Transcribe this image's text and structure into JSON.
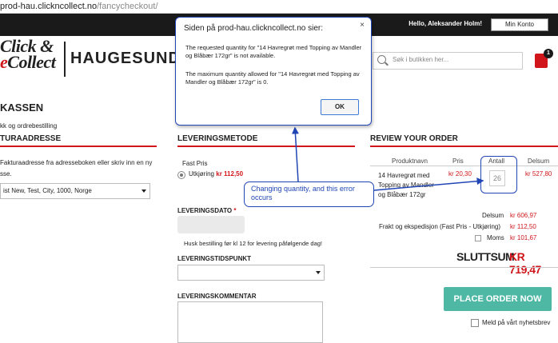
{
  "browser": {
    "url_host": "prod-hau.clickncollect.no",
    "url_path": "/fancycheckout/"
  },
  "topbar": {
    "greeting": "Hello, Aleksander Holm!",
    "account_button": "Min Konto"
  },
  "header": {
    "logo_line1": "Click &",
    "logo_line2_red": "e",
    "logo_line2": "Collect",
    "store_name": "HAUGESUND",
    "search_placeholder": "Søk i butikken her...",
    "cart_count": "1"
  },
  "left": {
    "title": "KASSEN",
    "subtitle": "kk og ordrebestilling",
    "section_title": "TURAADRESSE",
    "help_text": "Fakturaadresse fra adresseboken eller skriv inn en ny",
    "help_text2": "sse.",
    "address_select": "ist New, Test, City, 1000, Norge"
  },
  "delivery": {
    "section_title": "LEVERINGSMETODE",
    "fast_pris_label": "Fast Pris",
    "option_label": "Utkjøring",
    "option_price": "kr 112,50",
    "date_label": "LEVERINGSDATO",
    "date_required": "*",
    "date_note": "Husk bestilling før kl 12 for levering påfølgende dag!",
    "time_label": "LEVERINGSTIDSPUNKT",
    "comment_label": "LEVERINGSKOMMENTAR"
  },
  "review": {
    "section_title": "REVIEW YOUR ORDER",
    "col_product": "Produktnavn",
    "col_price": "Pris",
    "col_qty": "Antall",
    "col_total": "Delsum",
    "product_line1": "14 Havregrøt med",
    "product_line2": "Topping av Mandler",
    "product_line3": "og Blåbær 172gr",
    "product_price": "kr 20,30",
    "product_qty": "26",
    "product_total": "kr 527,80",
    "subtotal_label": "Delsum",
    "subtotal_value": "kr 606,97",
    "shipping_label": "Frakt og ekspedisjon (Fast Pris - Utkjøring)",
    "shipping_value": "kr 112,50",
    "tax_label": "Moms",
    "tax_value": "kr 101,67",
    "grand_label": "SLUTTSUM",
    "grand_value": "KR 719,47",
    "place_order": "PLACE ORDER NOW",
    "newsletter": "Meld på vårt nyhetsbrev"
  },
  "dialog": {
    "title": "Siden på prod-hau.clickncollect.no sier:",
    "close": "×",
    "message1": "The requested quantity for \"14 Havregrøt med Topping av Mandler og Blåbær 172gr\" is not available.",
    "message2": "The maximum quantity allowed for \"14 Havregrøt med Topping av Mandler og Blåbær 172gr\" is 0.",
    "ok": "OK"
  },
  "annotation": {
    "text": "Changing quantity, and this error occurs"
  },
  "colors": {
    "brand_red": "#d0161b",
    "annotation_blue": "#2046b5",
    "order_button": "#4fb8a5"
  }
}
